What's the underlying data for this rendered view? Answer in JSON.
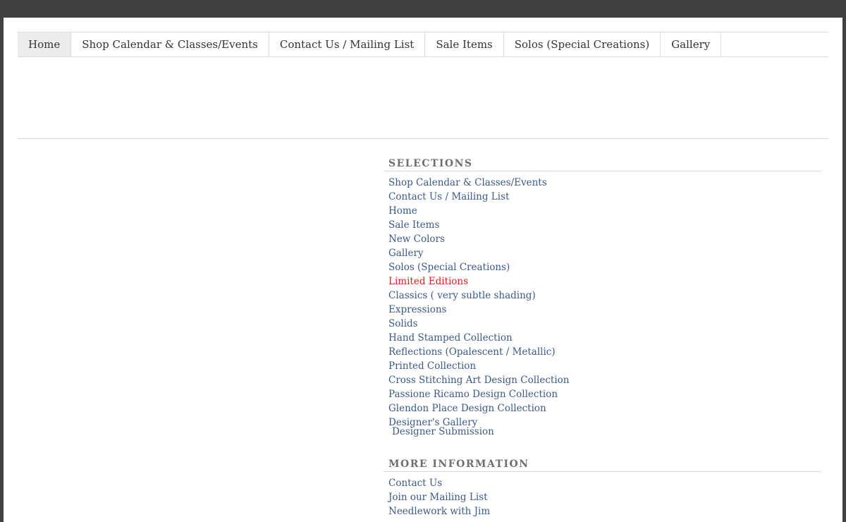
{
  "nav": {
    "tabs": [
      {
        "label": "Home"
      },
      {
        "label": "Shop Calendar & Classes/Events"
      },
      {
        "label": "Contact Us / Mailing List"
      },
      {
        "label": "Sale Items"
      },
      {
        "label": "Solos (Special Creations)"
      },
      {
        "label": "Gallery"
      }
    ],
    "active": "Home"
  },
  "selections": {
    "title": "SELECTIONS",
    "items": [
      "Shop Calendar & Classes/Events",
      "Contact Us / Mailing List",
      "Home",
      "Sale Items",
      "New Colors",
      "Gallery",
      "Solos (Special Creations)",
      "Limited Editions",
      "Classics ( very subtle shading)",
      "Expressions",
      "Solids",
      "Hand Stamped Collection",
      "Reflections (Opalescent / Metallic)",
      "Printed Collection",
      "Cross Stitching Art Design Collection",
      "Passione Ricamo Design Collection",
      "Glendon Place Design Collection",
      "Designer's Gallery",
      "Designer Submission"
    ],
    "highlight_color": "#e02020",
    "link_color": "#3c5a86"
  },
  "more_info": {
    "title": "MORE INFORMATION",
    "items": [
      "Contact Us",
      "Join our Mailing List",
      "Needlework with Jim"
    ]
  }
}
